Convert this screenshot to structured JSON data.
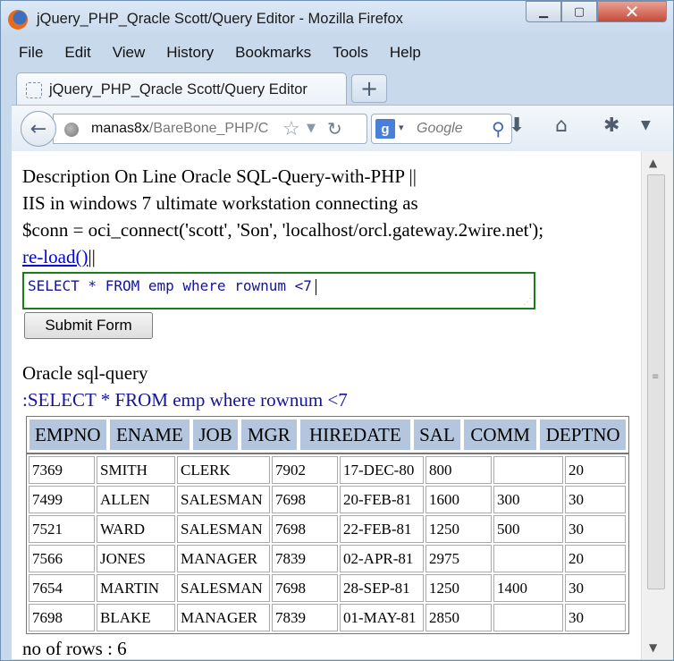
{
  "window": {
    "title": "jQuery_PHP_Qracle Scott/Query Editor - Mozilla Firefox",
    "minimize": "▁",
    "maximize": "▢",
    "close": "✕"
  },
  "menubar": [
    "File",
    "Edit",
    "View",
    "History",
    "Bookmarks",
    "Tools",
    "Help"
  ],
  "tab": {
    "label": "jQuery_PHP_Qracle Scott/Query Editor",
    "new_tab": "+"
  },
  "navbar": {
    "back": "←",
    "url_host": "manas8x",
    "url_path": "/BareBone_PHP/C",
    "star": "☆",
    "dropdown": "▼",
    "reload": "↻",
    "search_engine": "g",
    "search_drop": "▾",
    "search_placeholder": "Google",
    "search_glass": "⚲",
    "download": "⬇",
    "home": "⌂",
    "addon": "✱",
    "menu": "▼"
  },
  "content": {
    "desc_line1": "Description On Line Oracle SQL-Query-with-PHP ||",
    "desc_line2": "IIS in windows 7 ultimate workstation connecting as",
    "desc_line3": "$conn = oci_connect('scott', 'Son', 'localhost/orcl.gateway.2wire.net');",
    "reload_link": "re-load()",
    "reload_suffix": "||",
    "query_value": "SELECT * FROM emp where rownum <7",
    "submit_label": "Submit Form",
    "section_label": "Oracle sql-query",
    "query_echo": ":SELECT * FROM emp where rownum <7",
    "rows_label": "no of rows : 6"
  },
  "results": {
    "headers": [
      "EMPNO",
      "ENAME",
      "JOB",
      "MGR",
      "HIREDATE",
      "SAL",
      "COMM",
      "DEPTNO"
    ],
    "rows": [
      [
        "7369",
        "SMITH",
        "CLERK",
        "7902",
        "17-DEC-80",
        "800",
        "",
        "20"
      ],
      [
        "7499",
        "ALLEN",
        "SALESMAN",
        "7698",
        "20-FEB-81",
        "1600",
        "300",
        "30"
      ],
      [
        "7521",
        "WARD",
        "SALESMAN",
        "7698",
        "22-FEB-81",
        "1250",
        "500",
        "30"
      ],
      [
        "7566",
        "JONES",
        "MANAGER",
        "7839",
        "02-APR-81",
        "2975",
        "",
        "20"
      ],
      [
        "7654",
        "MARTIN",
        "SALESMAN",
        "7698",
        "28-SEP-81",
        "1250",
        "1400",
        "30"
      ],
      [
        "7698",
        "BLAKE",
        "MANAGER",
        "7839",
        "01-MAY-81",
        "2850",
        "",
        "30"
      ]
    ]
  },
  "colors": {
    "header_cell_bg": "#b3c6dd",
    "query_border": "#1a7d1a",
    "query_text": "#14149a",
    "link": "#0000ee"
  }
}
